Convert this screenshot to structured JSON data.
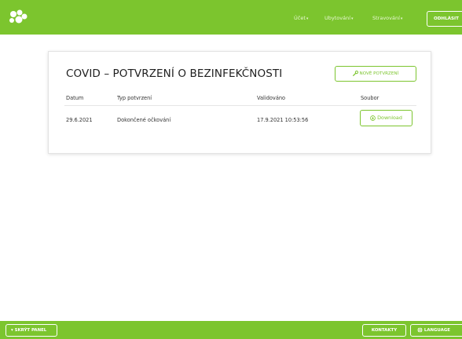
{
  "colors": {
    "accent": "#7cc52e",
    "header_text": "#e7f7d2",
    "text": "#1f1f1f"
  },
  "header": {
    "logo_icon": "hexagon-cluster-logo",
    "nav": [
      {
        "label": "Účet"
      },
      {
        "label": "Ubytování"
      },
      {
        "label": "Stravování"
      }
    ],
    "logout_label": "ODHLÁSIT"
  },
  "card": {
    "title": "COVID – POTVRZENÍ O BEZINFEKČNOSTI",
    "new_button_label": "NOVÉ POTVRZENÍ",
    "new_button_icon": "wrench-icon",
    "columns": [
      "Datum",
      "Typ potvrzení",
      "Validováno",
      "Soubor"
    ],
    "rows": [
      {
        "date": "29.6.2021",
        "type": "Dokončené očkování",
        "validated": "17.9.2021 10:53:56",
        "file_label": "Download",
        "file_icon": "download-circle-icon"
      }
    ]
  },
  "footer": {
    "hide_panel_label": "SKRÝT PANEL",
    "contacts_label": "KONTAKTY",
    "language_label": "LANGUAGE",
    "language_icon": "globe-icon"
  }
}
